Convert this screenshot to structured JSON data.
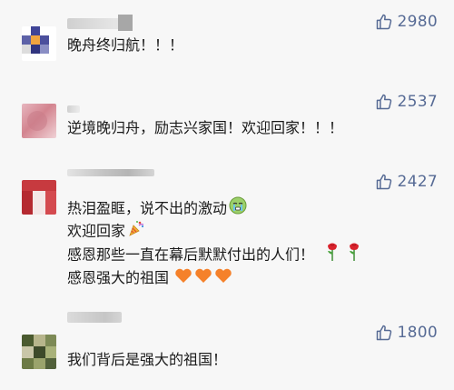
{
  "comments": [
    {
      "likes": "2980",
      "lines": [
        "晚舟终归航！！！"
      ]
    },
    {
      "likes": "2537",
      "lines": [
        "逆境晚归舟，励志兴家国！欢迎回家！！！"
      ]
    },
    {
      "likes": "2427",
      "lines": [
        "热泪盈眶，说不出的激动",
        "欢迎回家",
        "感恩那些一直在幕后默默付出的人们！",
        "感恩强大的祖国"
      ]
    },
    {
      "likes": "1800",
      "lines": [
        "我们背后是强大的祖国！"
      ]
    }
  ],
  "icons": {
    "like": "thumbs-up-icon",
    "crying_face": "crying-face-emoji",
    "party_popper": "party-popper-emoji",
    "rose": "rose-emoji",
    "orange_heart": "orange-heart-emoji"
  },
  "colors": {
    "like": "#576b95",
    "text": "#1a1a1a",
    "background": "#f7f7f7"
  }
}
